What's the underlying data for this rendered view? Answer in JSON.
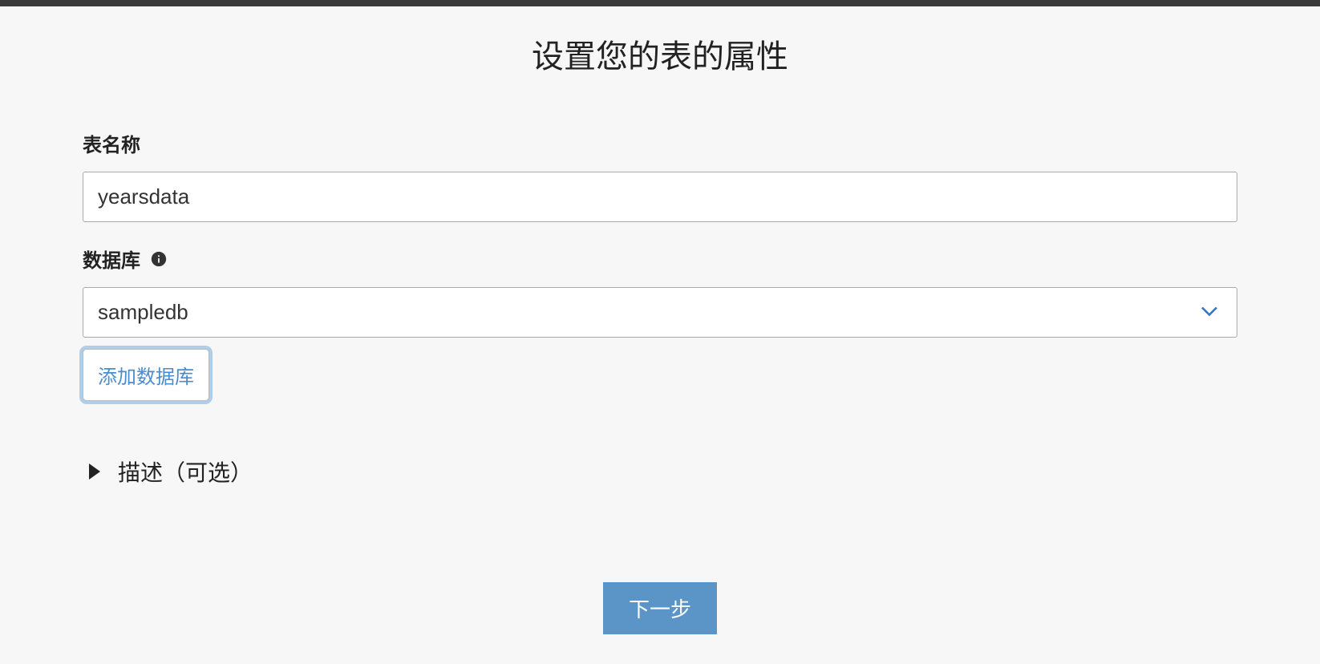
{
  "page_title": "设置您的表的属性",
  "form": {
    "table_name_label": "表名称",
    "table_name_value": "yearsdata",
    "database_label": "数据库",
    "database_selected": "sampledb",
    "add_database_label": "添加数据库"
  },
  "description_section": {
    "label": "描述（可选）"
  },
  "next_button_label": "下一步"
}
